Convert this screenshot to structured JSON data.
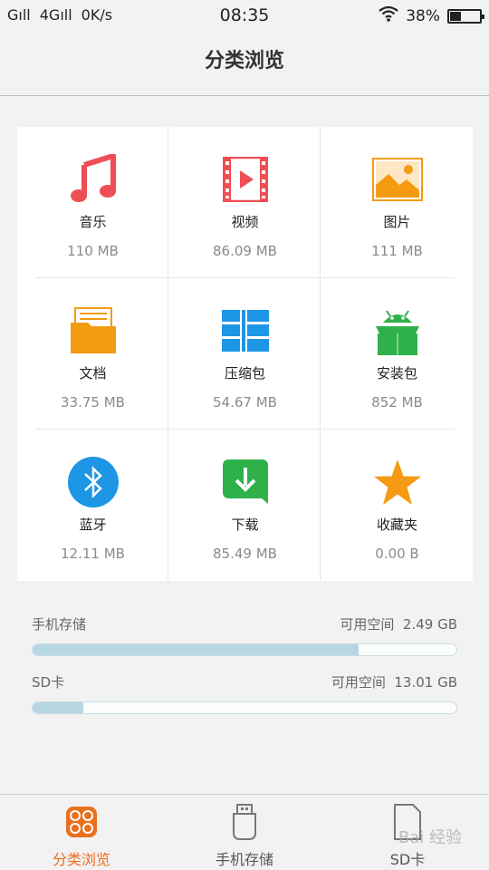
{
  "status": {
    "signal1": "Gıll",
    "signal2": "4Gıll",
    "speed": "0K/s",
    "time": "08:35",
    "battery": "38%",
    "battery_level": 0.38
  },
  "header": {
    "title": "分类浏览"
  },
  "categories": [
    {
      "label": "音乐",
      "size": "110 MB",
      "icon": "music-note-icon",
      "color": "#ee4f55"
    },
    {
      "label": "视频",
      "size": "86.09 MB",
      "icon": "video-film-icon",
      "color": "#ee4f55"
    },
    {
      "label": "图片",
      "size": "111 MB",
      "icon": "picture-icon",
      "color": "#f49a13"
    },
    {
      "label": "文档",
      "size": "33.75 MB",
      "icon": "document-folder-icon",
      "color": "#f49a13"
    },
    {
      "label": "压缩包",
      "size": "54.67 MB",
      "icon": "archive-icon",
      "color": "#1e96e6"
    },
    {
      "label": "安装包",
      "size": "852 MB",
      "icon": "android-package-icon",
      "color": "#2fb14a"
    },
    {
      "label": "蓝牙",
      "size": "12.11 MB",
      "icon": "bluetooth-icon",
      "color": "#1e96e6"
    },
    {
      "label": "下载",
      "size": "85.49 MB",
      "icon": "download-icon",
      "color": "#2fb14a"
    },
    {
      "label": "收藏夹",
      "size": "0.00 B",
      "icon": "star-icon",
      "color": "#f49a13"
    }
  ],
  "storage": [
    {
      "name": "手机存储",
      "free_label": "可用空间",
      "free": "2.49 GB",
      "used_fraction": 0.77
    },
    {
      "name": "SD卡",
      "free_label": "可用空间",
      "free": "13.01 GB",
      "used_fraction": 0.12
    }
  ],
  "tabs": [
    {
      "label": "分类浏览",
      "icon": "category-grid-icon",
      "active": true
    },
    {
      "label": "手机存储",
      "icon": "phone-storage-icon",
      "active": false
    },
    {
      "label": "SD卡",
      "icon": "sd-card-icon",
      "active": false
    }
  ],
  "watermark": "Bai 经验",
  "colors": {
    "accent": "#e8701e",
    "storage_fill": "#b6d6e2"
  }
}
